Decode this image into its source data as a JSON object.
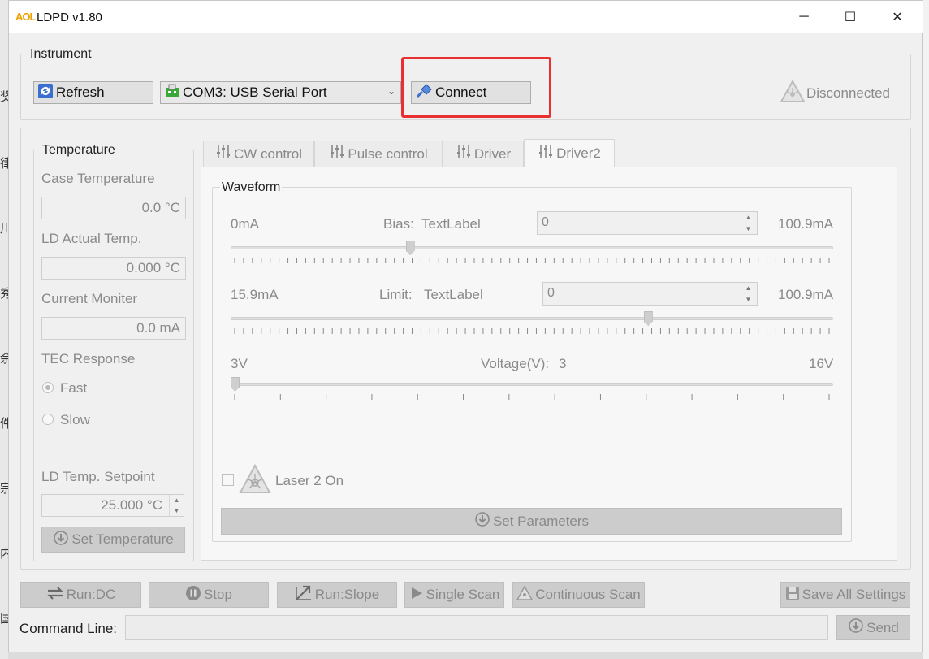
{
  "window": {
    "logo": "AOL",
    "title": "LDPD v1.80",
    "minimize": "─",
    "maximize": "☐",
    "close": "✕"
  },
  "instrument": {
    "group_title": "Instrument",
    "refresh_label": "Refresh",
    "port_value": "COM3: USB Serial Port",
    "connect_label": "Connect",
    "status_text": "Disconnected"
  },
  "temperature": {
    "group_title": "Temperature",
    "case_label": "Case Temperature",
    "case_value": "0.0 °C",
    "ld_actual_label": "LD Actual Temp.",
    "ld_actual_value": "0.000 °C",
    "current_label": "Current Moniter",
    "current_value": "0.0 mA",
    "tec_label": "TEC Response",
    "fast_label": "Fast",
    "slow_label": "Slow",
    "setpoint_label": "LD Temp. Setpoint",
    "setpoint_value": "25.000 °C",
    "set_button": "Set Temperature"
  },
  "tabs": [
    {
      "label": "CW control",
      "icon": "sliders-icon"
    },
    {
      "label": "Pulse control",
      "icon": "sliders-icon"
    },
    {
      "label": "Driver",
      "icon": "sliders-icon"
    },
    {
      "label": "Driver2",
      "icon": "sliders-icon"
    }
  ],
  "waveform": {
    "group_title": "Waveform",
    "bias": {
      "min_label": "0mA",
      "label": "Bias:",
      "text_label": "TextLabel",
      "value": "0",
      "max_label": "100.9mA",
      "slider_fraction": 0.295
    },
    "limit": {
      "min_label": "15.9mA",
      "label": "Limit:",
      "text_label": "TextLabel",
      "value": "0",
      "max_label": "100.9mA",
      "slider_fraction": 0.696
    },
    "voltage": {
      "min_label": "3V",
      "label": "Voltage(V):",
      "value": "3",
      "max_label": "16V",
      "slider_fraction": 0.0
    },
    "laser_label": "Laser 2 On",
    "set_params_button": "Set Parameters"
  },
  "actions": {
    "run_dc": "Run:DC",
    "stop": "Stop",
    "run_slope": "Run:Slope",
    "single_scan": "Single Scan",
    "continuous_scan": "Continuous Scan",
    "save_all": "Save All Settings"
  },
  "command": {
    "label": "Command Line:",
    "value": "",
    "send_button": "Send"
  },
  "background_chars": [
    "奖",
    "律",
    "川",
    "秀",
    "余",
    "件",
    "宗",
    "内",
    "国"
  ],
  "colors": {
    "highlight": "#e83030",
    "logo": "#f0a000"
  }
}
